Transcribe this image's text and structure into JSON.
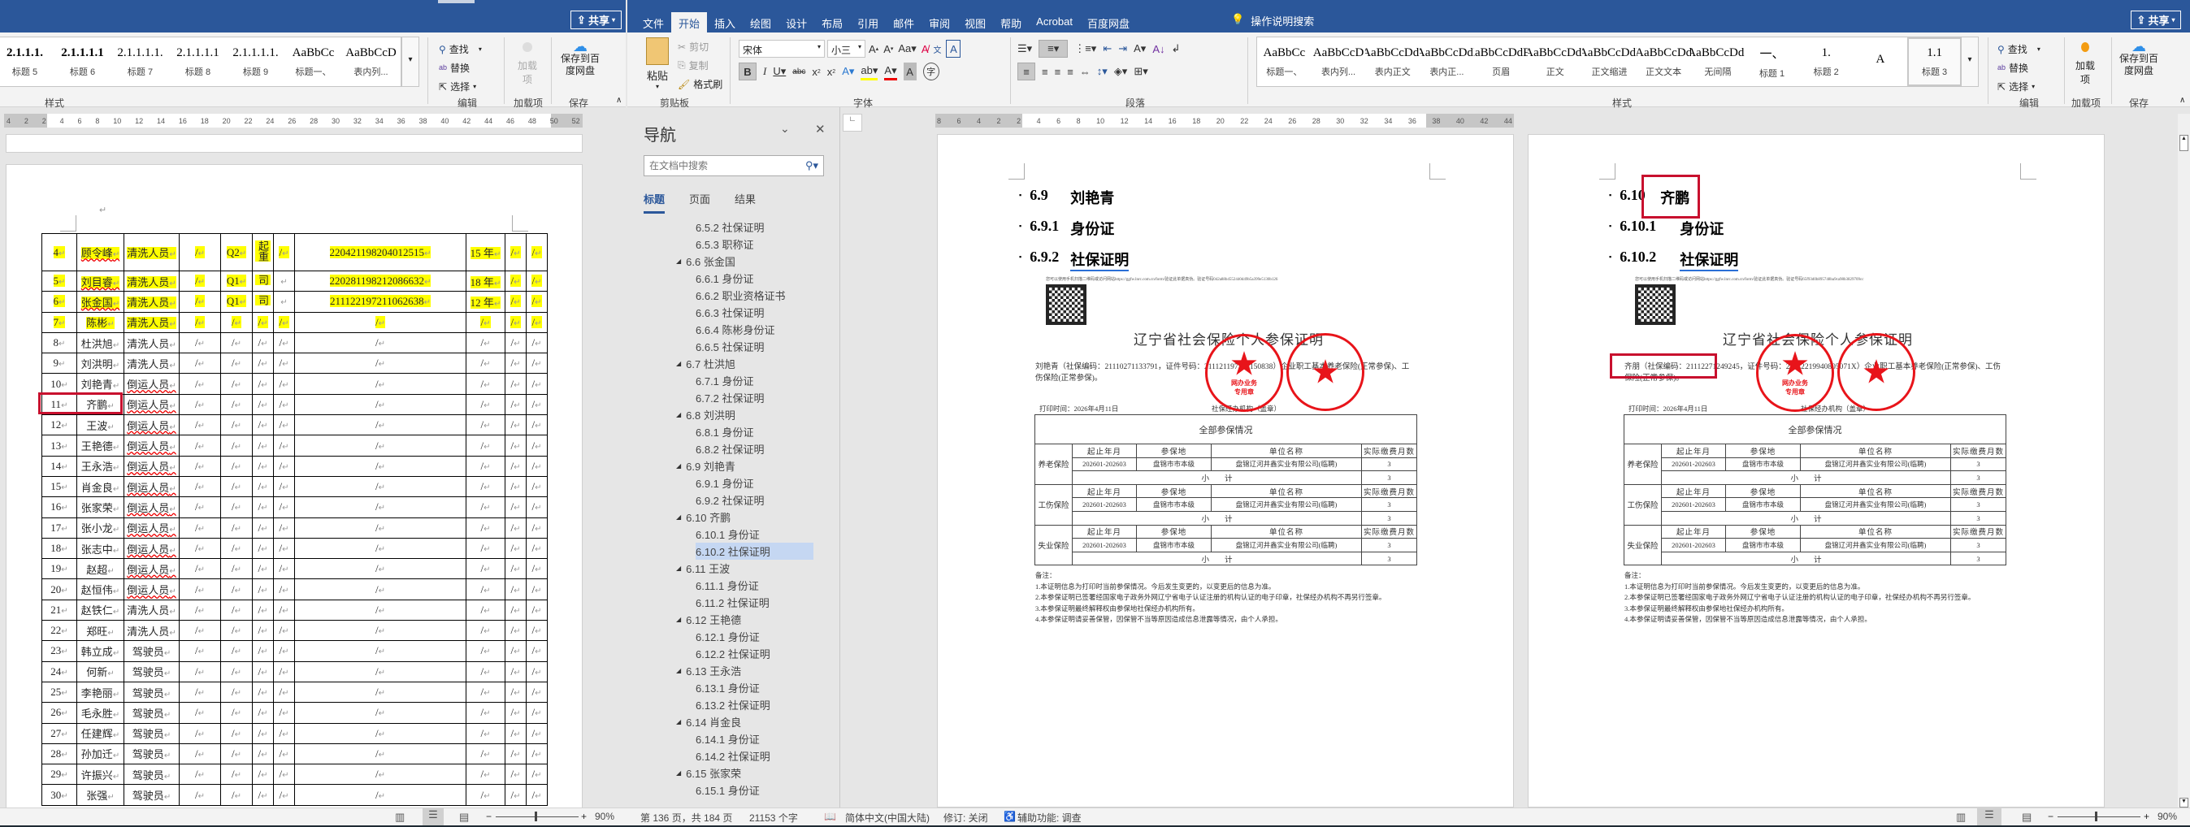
{
  "left_window": {
    "share_label": "共享",
    "styles": [
      {
        "preview": "2.1.1.1.",
        "name": "标题 5"
      },
      {
        "preview": "2.1.1.1.1",
        "name": "标题 6"
      },
      {
        "preview": "2.1.1.1.1.",
        "name": "标题 7"
      },
      {
        "preview": "2.1.1.1.1",
        "name": "标题 8"
      },
      {
        "preview": "2.1.1.1.1.",
        "name": "标题 9"
      },
      {
        "preview": "AaBbCc",
        "name": "标题一、"
      },
      {
        "preview": "AaBbCcD",
        "name": "表内列..."
      }
    ],
    "styles_group": "样式",
    "editing": {
      "find": "查找",
      "replace": "替换",
      "select": "选择",
      "group": "编辑"
    },
    "addins": {
      "label": "加载项",
      "group": "加载项"
    },
    "save": {
      "label": "保存到百度网盘",
      "group": "保存"
    },
    "ruler": [
      "4",
      "2",
      "2",
      "4",
      "6",
      "8",
      "10",
      "12",
      "14",
      "16",
      "18",
      "20",
      "22",
      "24",
      "26",
      "28",
      "30",
      "32",
      "34",
      "36",
      "38",
      "40",
      "42",
      "44",
      "46",
      "48",
      "50",
      "52"
    ],
    "table_rows": [
      [
        "4",
        "顾令峰",
        "清洗人员",
        "/",
        "Q2",
        "起重",
        "/",
        "220421198204012515",
        "15 年",
        "/",
        "/"
      ],
      [
        "5",
        "刘目睿",
        "清洗人员",
        "/",
        "Q1",
        "司",
        "",
        "220281198212086632",
        "18 年",
        "/",
        "/"
      ],
      [
        "6",
        "张金国",
        "清洗人员",
        "/",
        "Q1",
        "司",
        "",
        "211122197211062638",
        "12 年",
        "/",
        "/"
      ],
      [
        "7",
        "陈彬",
        "清洗人员",
        "/",
        "/",
        "/",
        "/",
        "/",
        "/",
        "/",
        "/"
      ],
      [
        "8",
        "杜洪旭",
        "清洗人员",
        "/",
        "/",
        "/",
        "/",
        "/",
        "/",
        "/",
        "/"
      ],
      [
        "9",
        "刘洪明",
        "清洗人员",
        "/",
        "/",
        "/",
        "/",
        "/",
        "/",
        "/",
        "/"
      ],
      [
        "10",
        "刘艳青",
        "倒运人员",
        "/",
        "/",
        "/",
        "/",
        "/",
        "/",
        "/",
        "/"
      ],
      [
        "11",
        "齐鹏",
        "倒运人员",
        "/",
        "/",
        "/",
        "/",
        "/",
        "/",
        "/",
        "/"
      ],
      [
        "12",
        "王波",
        "倒运人员",
        "/",
        "/",
        "/",
        "/",
        "/",
        "/",
        "/",
        "/"
      ],
      [
        "13",
        "王艳德",
        "倒运人员",
        "/",
        "/",
        "/",
        "/",
        "/",
        "/",
        "/",
        "/"
      ],
      [
        "14",
        "王永浩",
        "倒运人员",
        "/",
        "/",
        "/",
        "/",
        "/",
        "/",
        "/",
        "/"
      ],
      [
        "15",
        "肖金良",
        "倒运人员",
        "/",
        "/",
        "/",
        "/",
        "/",
        "/",
        "/",
        "/"
      ],
      [
        "16",
        "张家荣",
        "倒运人员",
        "/",
        "/",
        "/",
        "/",
        "/",
        "/",
        "/",
        "/"
      ],
      [
        "17",
        "张小龙",
        "倒运人员",
        "/",
        "/",
        "/",
        "/",
        "/",
        "/",
        "/",
        "/"
      ],
      [
        "18",
        "张志中",
        "倒运人员",
        "/",
        "/",
        "/",
        "/",
        "/",
        "/",
        "/",
        "/"
      ],
      [
        "19",
        "赵超",
        "倒运人员",
        "/",
        "/",
        "/",
        "/",
        "/",
        "/",
        "/",
        "/"
      ],
      [
        "20",
        "赵恒伟",
        "倒运人员",
        "/",
        "/",
        "/",
        "/",
        "/",
        "/",
        "/",
        "/"
      ],
      [
        "21",
        "赵铁仁",
        "清洗人员",
        "/",
        "/",
        "/",
        "/",
        "/",
        "/",
        "/",
        "/"
      ],
      [
        "22",
        "郑旺",
        "清洗人员",
        "/",
        "/",
        "/",
        "/",
        "/",
        "/",
        "/",
        "/"
      ],
      [
        "23",
        "韩立成",
        "驾驶员",
        "/",
        "/",
        "/",
        "/",
        "/",
        "/",
        "/",
        "/"
      ],
      [
        "24",
        "何新",
        "驾驶员",
        "/",
        "/",
        "/",
        "/",
        "/",
        "/",
        "/",
        "/"
      ],
      [
        "25",
        "李艳丽",
        "驾驶员",
        "/",
        "/",
        "/",
        "/",
        "/",
        "/",
        "/",
        "/"
      ],
      [
        "26",
        "毛永胜",
        "驾驶员",
        "/",
        "/",
        "/",
        "/",
        "/",
        "/",
        "/",
        "/"
      ],
      [
        "27",
        "任建辉",
        "驾驶员",
        "/",
        "/",
        "/",
        "/",
        "/",
        "/",
        "/",
        "/"
      ],
      [
        "28",
        "孙加迁",
        "驾驶员",
        "/",
        "/",
        "/",
        "/",
        "/",
        "/",
        "/",
        "/"
      ],
      [
        "29",
        "许振兴",
        "驾驶员",
        "/",
        "/",
        "/",
        "/",
        "/",
        "/",
        "/",
        "/"
      ],
      [
        "30",
        "张强",
        "驾驶员",
        "/",
        "/",
        "/",
        "/",
        "/",
        "/",
        "/",
        "/"
      ]
    ],
    "highlighted_row_numbers": [
      "4",
      "5",
      "6",
      "7"
    ],
    "boxed_row_number": "11",
    "status": {
      "zoom": "90%"
    }
  },
  "right_window": {
    "tabs": [
      "文件",
      "开始",
      "插入",
      "绘图",
      "设计",
      "布局",
      "引用",
      "邮件",
      "审阅",
      "视图",
      "帮助",
      "Acrobat",
      "百度网盘"
    ],
    "active_tab": "开始",
    "tell_me": "操作说明搜索",
    "share_label": "共享",
    "clipboard": {
      "paste": "粘贴",
      "cut": "剪切",
      "copy": "复制",
      "format_painter": "格式刷",
      "group": "剪贴板"
    },
    "font": {
      "name": "宋体",
      "size": "小三",
      "group": "字体"
    },
    "paragraph": {
      "group": "段落"
    },
    "styles": [
      {
        "preview": "AaBbCc",
        "name": "标题一、"
      },
      {
        "preview": "AaBbCcD",
        "name": "表内列..."
      },
      {
        "preview": "AaBbCcDdI",
        "name": "表内正文"
      },
      {
        "preview": "AaBbCcDdI",
        "name": "表内正..."
      },
      {
        "preview": "AaBbCcDdEe",
        "name": "页眉"
      },
      {
        "preview": "AaBbCcDdI",
        "name": "正文"
      },
      {
        "preview": "AaBbCcDdI",
        "name": "正文缩进"
      },
      {
        "preview": "AaBbCcDd",
        "name": "正文文本"
      },
      {
        "preview": "AaBbCcDdI",
        "name": "无间隔"
      },
      {
        "preview": "一、",
        "name": "标题 1"
      },
      {
        "preview": "1.",
        "name": "标题 2"
      },
      {
        "preview": "A",
        "name": ""
      },
      {
        "preview": "1.1",
        "name": "标题 3"
      }
    ],
    "selected_style": "标题 3",
    "styles_group": "样式",
    "editing": {
      "find": "查找",
      "replace": "替换",
      "select": "选择",
      "group": "编辑"
    },
    "addins": {
      "label": "加载项",
      "group": "加载项"
    },
    "save": {
      "label": "保存到百度网盘",
      "group": "保存"
    },
    "ruler": [
      "8",
      "6",
      "4",
      "2",
      "2",
      "4",
      "6",
      "8",
      "10",
      "12",
      "14",
      "16",
      "18",
      "20",
      "22",
      "24",
      "26",
      "28",
      "30",
      "32",
      "34",
      "36",
      "38",
      "40",
      "42",
      "44"
    ],
    "nav": {
      "title": "导航",
      "search_placeholder": "在文档中搜索",
      "tabs": [
        "标题",
        "页面",
        "结果"
      ],
      "active_tab": "标题",
      "items": [
        {
          "text": "6.5.2 社保证明",
          "level": 3
        },
        {
          "text": "6.5.3 职称证",
          "level": 3
        },
        {
          "text": "6.6 张金国",
          "level": 2
        },
        {
          "text": "6.6.1 身份证",
          "level": 3
        },
        {
          "text": "6.6.2 职业资格证书",
          "level": 3
        },
        {
          "text": "6.6.3 社保证明",
          "level": 3
        },
        {
          "text": "6.6.4 陈彬身份证",
          "level": 3
        },
        {
          "text": "6.6.5 社保证明",
          "level": 3
        },
        {
          "text": "6.7 杜洪旭",
          "level": 2
        },
        {
          "text": "6.7.1 身份证",
          "level": 3
        },
        {
          "text": "6.7.2 社保证明",
          "level": 3
        },
        {
          "text": "6.8 刘洪明",
          "level": 2
        },
        {
          "text": "6.8.1 身份证",
          "level": 3
        },
        {
          "text": "6.8.2 社保证明",
          "level": 3
        },
        {
          "text": "6.9 刘艳青",
          "level": 2
        },
        {
          "text": "6.9.1 身份证",
          "level": 3
        },
        {
          "text": "6.9.2 社保证明",
          "level": 3
        },
        {
          "text": "6.10 齐鹏",
          "level": 2
        },
        {
          "text": "6.10.1 身份证",
          "level": 3
        },
        {
          "text": "6.10.2 社保证明",
          "level": 3
        },
        {
          "text": "6.11 王波",
          "level": 2
        },
        {
          "text": "6.11.1 身份证",
          "level": 3
        },
        {
          "text": "6.11.2 社保证明",
          "level": 3
        },
        {
          "text": "6.12 王艳德",
          "level": 2
        },
        {
          "text": "6.12.1 身份证",
          "level": 3
        },
        {
          "text": "6.12.2 社保证明",
          "level": 3
        },
        {
          "text": "6.13 王永浩",
          "level": 2
        },
        {
          "text": "6.13.1 身份证",
          "level": 3
        },
        {
          "text": "6.13.2 社保证明",
          "level": 3
        },
        {
          "text": "6.14 肖金良",
          "level": 2
        },
        {
          "text": "6.14.1 身份证",
          "level": 3
        },
        {
          "text": "6.14.2 社保证明",
          "level": 3
        },
        {
          "text": "6.15 张家荣",
          "level": 2
        },
        {
          "text": "6.15.1 身份证",
          "level": 3
        }
      ],
      "selected": "6.10.2 社保证明"
    },
    "pages": [
      {
        "headings": [
          {
            "num": "6.9",
            "text": "刘艳青"
          },
          {
            "num": "6.9.1",
            "text": "身份证"
          },
          {
            "num": "6.9.2",
            "text": "社保证明"
          }
        ],
        "verify_text": "您可以使用手机扫描二维码或访问网站https://ggfw.lnrc.com.cn/form/验证此单据真伪。验证号码042a88b4552440d49b5a399e5130b126",
        "person_text": "刘艳青（社保编码：21110271133791，证件号码：211121197205150838）企业职工基本养老保险(正常参保)、工伤保险(正常参保)。"
      },
      {
        "headings": [
          {
            "num": "6.10",
            "text": "齐鹏"
          },
          {
            "num": "6.10.1",
            "text": "身份证"
          },
          {
            "num": "6.10.2",
            "text": "社保证明"
          }
        ],
        "verify_text": "您可以使用手机扫描二维码或访问网站https://ggfw.lnrc.com.cn/form/验证此单据真伪。验证号码65f93d0b895748ba9ca98b3829709cc",
        "person_text": "齐朋（社保编码：21112271249245，证件号码：21112219940805071X）企业职工基本养老保险(正常参保)、工伤保险(正常参保)。"
      }
    ],
    "certificate": {
      "title": "辽宁省社会保险个人参保证明",
      "print_time": "打印时间：2026年4月11日",
      "agency": "社保经办机构（盖章）",
      "table_title": "全部参保情况",
      "columns": [
        "起止年月",
        "参保地",
        "单位名称",
        "实际缴费月数"
      ],
      "sections": [
        {
          "type": "养老保险",
          "period": "202601-202603",
          "place": "盘锦市市本级",
          "employer": "盘锦辽河井鑫实业有限公司(临聘)",
          "months": "3",
          "subtotal_label": "小　　计",
          "subtotal": "3"
        },
        {
          "type": "工伤保险",
          "period": "202601-202603",
          "place": "盘锦市市本级",
          "employer": "盘锦辽河井鑫实业有限公司(临聘)",
          "months": "3",
          "subtotal_label": "小　　计",
          "subtotal": "3"
        },
        {
          "type": "失业保险",
          "period": "202601-202603",
          "place": "盘锦市市本级",
          "employer": "盘锦辽河井鑫实业有限公司(临聘)",
          "months": "3",
          "subtotal_label": "小　　计",
          "subtotal": "3"
        }
      ],
      "notes_title": "备注：",
      "notes": [
        "1.本证明信息为打印时当前参保情况。今后发生变更的，以变更后的信息为准。",
        "2.本参保证明已签署经国家电子政务外网辽宁省电子认证注册的机构认证的电子印章，社保经办机构不再另行签章。",
        "3.本参保证明最终解释权由参保地社保经办机构所有。",
        "4.本参保证明请妥善保管，因保管不当等原因造成信息泄露等情况，由个人承担。"
      ],
      "stamp_text": [
        "网办业务",
        "专用章"
      ]
    },
    "status": {
      "page": "第 136 页，共 184 页",
      "words": "21153 个字",
      "language": "简体中文(中国大陆)",
      "track_changes": "修订: 关闭",
      "accessibility": "辅助功能: 调查",
      "zoom": "90%"
    }
  },
  "colors": {
    "title_bar": "#2b579a",
    "highlight": "#ffff00",
    "annotation_red": "#c8102e",
    "stamp_red": "#e8141a",
    "nav_selected": "#c5d7f2"
  }
}
